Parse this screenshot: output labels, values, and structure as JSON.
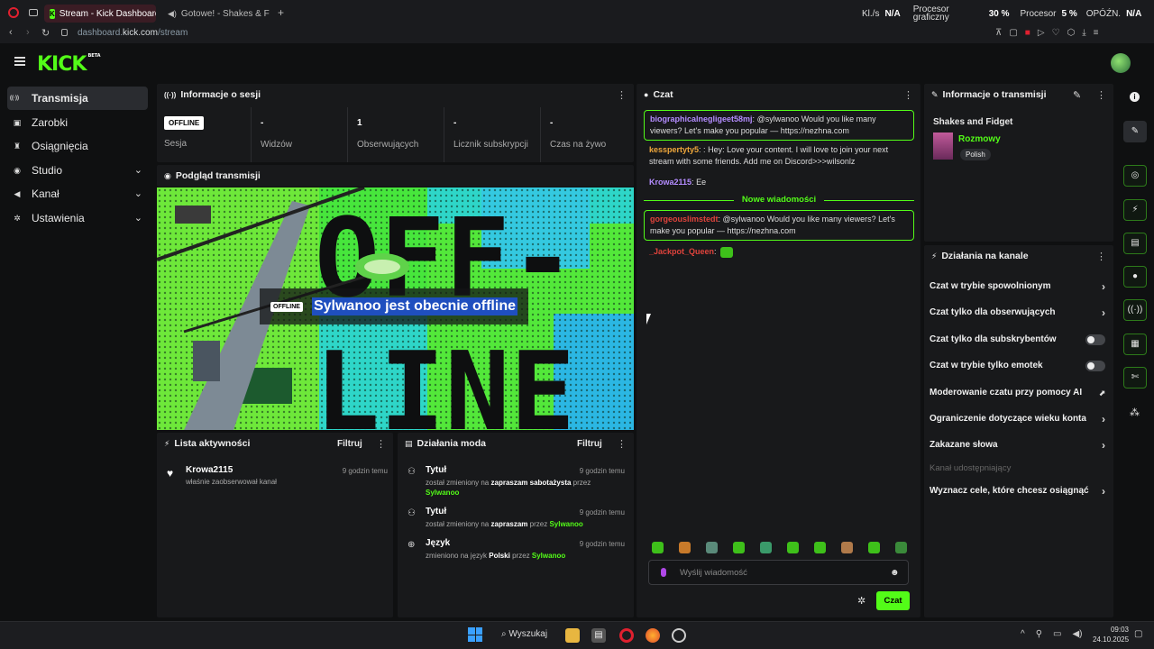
{
  "browser": {
    "tabs": [
      {
        "label": "Stream - Kick Dashboard",
        "active": true
      },
      {
        "label": "Gotowe! - Shakes & F",
        "active": false
      }
    ],
    "new_tab": "+",
    "url_host": "dashboard.",
    "url_domain": "kick.com",
    "url_path": "/stream",
    "stats": {
      "kbs_label": "Kl./s",
      "kbs_value": "N/A",
      "gpu_label_1": "Procesor",
      "gpu_label_2": "graficzny",
      "gpu_value": "30 %",
      "cpu_label": "Procesor",
      "cpu_value": "5 %",
      "delay_label": "OPÓŹN.",
      "delay_value": "N/A"
    }
  },
  "app": {
    "logo": "KICK",
    "logo_badge": "BETA"
  },
  "sidebar": {
    "items": [
      {
        "label": "Transmisja",
        "icon": "broadcast-icon",
        "glyph": "((·))",
        "active": true,
        "expandable": false
      },
      {
        "label": "Zarobki",
        "icon": "wallet-icon",
        "glyph": "▣",
        "active": false,
        "expandable": false
      },
      {
        "label": "Osiągnięcia",
        "icon": "trophy-icon",
        "glyph": "♜",
        "active": false,
        "expandable": false
      },
      {
        "label": "Studio",
        "icon": "palette-icon",
        "glyph": "◉",
        "active": false,
        "expandable": true
      },
      {
        "label": "Kanał",
        "icon": "megaphone-icon",
        "glyph": "◀",
        "active": false,
        "expandable": true
      },
      {
        "label": "Ustawienia",
        "icon": "gear-icon",
        "glyph": "✲",
        "active": false,
        "expandable": true
      }
    ]
  },
  "session": {
    "title": "Informacje o sesji",
    "status": "OFFLINE",
    "status_label": "Sesja",
    "stats": [
      {
        "value": "-",
        "label": "Widzów"
      },
      {
        "value": "1",
        "label": "Obserwujących"
      },
      {
        "value": "-",
        "label": "Licznik subskrypcji"
      },
      {
        "value": "-",
        "label": "Czas na żywo"
      }
    ]
  },
  "preview": {
    "title": "Podgląd transmisji",
    "badge": "OFFLINE",
    "message": "Sylwanoo jest obecnie offline",
    "art_text_1": "OFF-",
    "art_text_2": "LINE"
  },
  "activity": {
    "title": "Lista aktywności",
    "filter": "Filtruj",
    "items": [
      {
        "name": "Krowa2115",
        "desc": "właśnie zaobserwował kanał",
        "time": "9 godzin temu"
      }
    ]
  },
  "mod_actions": {
    "title": "Działania moda",
    "filter": "Filtruj",
    "items": [
      {
        "title": "Tytuł",
        "pre": "został zmieniony na",
        "target": "zapraszam sabotażysta",
        "mid": "przez",
        "by": "Sylwanoo",
        "time": "9 godzin temu"
      },
      {
        "title": "Tytuł",
        "pre": "został zmieniony na",
        "target": "zapraszam",
        "mid": "przez",
        "by": "Sylwanoo",
        "time": "9 godzin temu"
      },
      {
        "title": "Język",
        "pre": "zmieniono na język",
        "target": "Polski",
        "mid": "przez",
        "by": "Sylwanoo",
        "time": "9 godzin temu"
      }
    ]
  },
  "chat": {
    "title": "Czat",
    "messages": [
      {
        "user": "biographicalnegligeet58mj",
        "sep": ":",
        "text": "@sylwanoo Would you like many viewers? Let's make you popular — https://nezhna.com",
        "user_color": "#b48cff",
        "highlight": true
      },
      {
        "user": "kesspertyty5",
        "sep": ": :",
        "text": "Hey: Love your content. I will love to join your next stream with some friends. Add me on Discord>>>wilsonlz",
        "user_color": "#f0a83c",
        "highlight": false
      },
      {
        "user": "Krowa2115",
        "sep": ":",
        "text": "Ee",
        "user_color": "#b48cff",
        "highlight": false
      },
      {
        "user": "gorgeouslimstedt",
        "sep": ":",
        "text": "@sylwanoo Would you like many viewers? Let's make you popular — https://nezhna.com",
        "user_color": "#e0433c",
        "highlight": true
      },
      {
        "user": "_Jackpot_Queen",
        "sep": ":",
        "text": "",
        "user_color": "#e0433c",
        "highlight": false
      }
    ],
    "new_messages_label": "Nowe wiadomości",
    "input_placeholder": "Wyślij wiadomość",
    "send_label": "Czat"
  },
  "stream_info": {
    "title": "Informacje o transmisji",
    "game": "Shakes and Fidget",
    "category": "Rozmowy",
    "language_tag": "Polish"
  },
  "channel_actions": {
    "title": "Działania na kanale",
    "items": [
      {
        "label": "Czat w trybie spowolnionym",
        "control": "chevron"
      },
      {
        "label": "Czat tylko dla obserwujących",
        "control": "chevron"
      },
      {
        "label": "Czat tylko dla subskrybentów",
        "control": "toggle",
        "on": false
      },
      {
        "label": "Czat w trybie tylko emotek",
        "control": "toggle",
        "on": false
      },
      {
        "label": "Moderowanie czatu przy pomocy AI",
        "control": "chart"
      },
      {
        "label": "Ograniczenie dotyczące wieku konta",
        "control": "chevron"
      },
      {
        "label": "Zakazane słowa",
        "control": "chevron"
      }
    ],
    "shared_label": "Kanał udostępniający",
    "goal_label": "Wyznacz cele, które chcesz osiągnąć"
  },
  "taskbar": {
    "search": "Wyszukaj",
    "time": "09:03",
    "date": "24.10.2025"
  },
  "colors": {
    "accent": "#53fc18",
    "panel": "#18191b",
    "bg": "#0f1011"
  }
}
